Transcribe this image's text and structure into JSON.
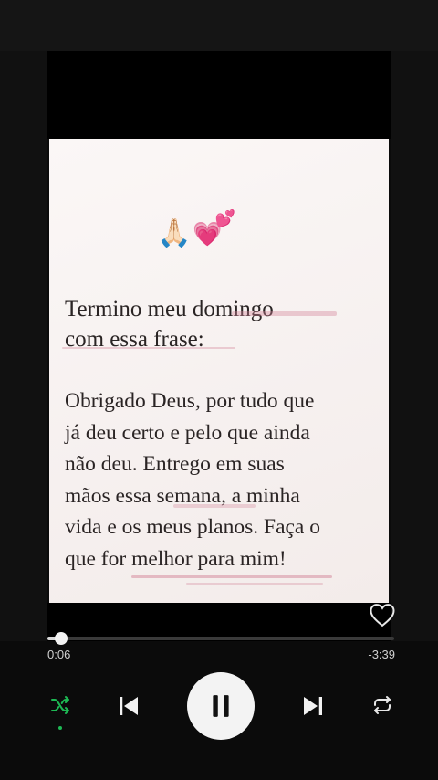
{
  "post": {
    "emoji": "🙏🏻",
    "emoji_heart": "💗",
    "emoji_heart_small": "💕",
    "heading_line1": "Termino meu domingo",
    "heading_line2": "com essa frase:",
    "body_lines": [
      "Obrigado Deus, por tudo que",
      "já deu certo e pelo que ainda",
      "não deu. Entrego em suas",
      "mãos essa semana, a minha",
      "vida e os meus planos. Faça o",
      "que for melhor para mim!"
    ]
  },
  "player": {
    "elapsed": "0:06",
    "remaining": "-3:39",
    "progress_fraction": 0.04,
    "liked": false,
    "shuffle_on": true,
    "accent_color": "#1db954"
  },
  "icons": {
    "like": "heart-outline-icon",
    "shuffle": "shuffle-icon",
    "previous": "skip-previous-icon",
    "pause": "pause-icon",
    "next": "skip-next-icon",
    "repeat": "repeat-icon"
  }
}
